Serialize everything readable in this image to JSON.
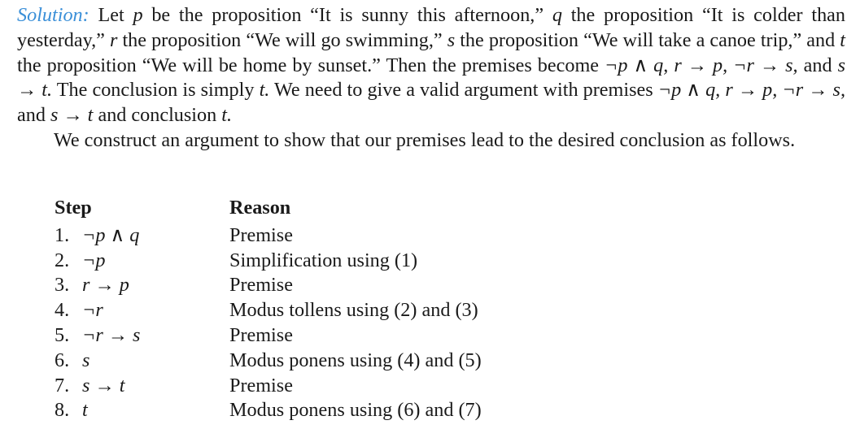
{
  "solution": {
    "label": "Solution:",
    "p1": {
      "t01": " Let ",
      "v01": "p",
      "t02": " be the proposition “It is sunny this afternoon,” ",
      "v02": "q",
      "t03": " the proposition “It is colder than yesterday,” ",
      "v03": "r",
      "t04": " the proposition “We will go swimming,” ",
      "v04": "s",
      "t05": " the proposition “We will take a canoe trip,” and ",
      "v05": "t",
      "t06": " the proposition “We will be home by sunset.” Then the premises become ",
      "e01": "¬p ∧ q, r → p, ¬r → s,",
      "t07": " and ",
      "e02": "s → t.",
      "t08": " The conclusion is simply ",
      "e03": "t.",
      "t09": " We need to give a valid argument with premises ",
      "e04": "¬p ∧ q, r → p, ¬r → s,",
      "t10": " and ",
      "e05": "s → t",
      "t11": " and conclusion ",
      "e06": "t.",
      "t12": ""
    },
    "p2": "We construct an argument to show that our premises lead to the desired conclusion as follows."
  },
  "table": {
    "header_step": "Step",
    "header_reason": "Reason",
    "rows": [
      {
        "num": "1.",
        "step": "¬p ∧ q",
        "reason": "Premise"
      },
      {
        "num": "2.",
        "step": "¬p",
        "reason": "Simplification using (1)"
      },
      {
        "num": "3.",
        "step": "r → p",
        "reason": "Premise"
      },
      {
        "num": "4.",
        "step": "¬r",
        "reason": "Modus tollens using (2) and (3)"
      },
      {
        "num": "5.",
        "step": "¬r → s",
        "reason": "Premise"
      },
      {
        "num": "6.",
        "step": "s",
        "reason": "Modus ponens using (4) and (5)"
      },
      {
        "num": "7.",
        "step": "s → t",
        "reason": "Premise"
      },
      {
        "num": "8.",
        "step": "t",
        "reason": "Modus ponens using (6) and (7)"
      }
    ]
  },
  "colors": {
    "label": "#3a8fd8",
    "text": "#1a1a1a"
  }
}
